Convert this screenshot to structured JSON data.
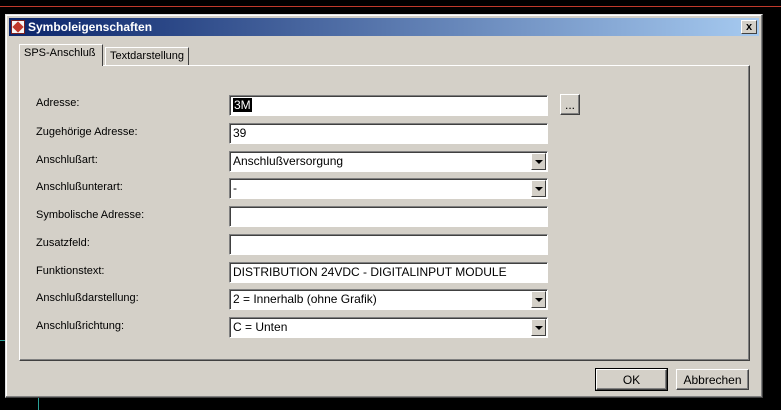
{
  "dialog": {
    "title": "Symboleigenschaften",
    "close_label": "x"
  },
  "tabs": [
    {
      "label": "SPS-Anschluß",
      "active": true
    },
    {
      "label": "Textdarstellung",
      "active": false
    }
  ],
  "fields": [
    {
      "label": "Adresse:",
      "value": "3M",
      "type": "text",
      "selected": true
    },
    {
      "label": "Zugehörige Adresse:",
      "value": "39",
      "type": "text"
    },
    {
      "label": "Anschlußart:",
      "value": "Anschlußversorgung",
      "type": "select"
    },
    {
      "label": "Anschlußunterart:",
      "value": "-",
      "type": "select"
    },
    {
      "label": "Symbolische Adresse:",
      "value": "",
      "type": "text"
    },
    {
      "label": "Zusatzfeld:",
      "value": "",
      "type": "text"
    },
    {
      "label": "Funktionstext:",
      "value": "DISTRIBUTION 24VDC - DIGITALINPUT MODULE",
      "type": "text"
    },
    {
      "label": "Anschlußdarstellung:",
      "value": "2 = Innerhalb (ohne Grafik)",
      "type": "select"
    },
    {
      "label": "Anschlußrichtung:",
      "value": "C = Unten",
      "type": "select"
    }
  ],
  "browse_button_label": "...",
  "buttons": {
    "ok": "OK",
    "cancel": "Abbrechen"
  }
}
